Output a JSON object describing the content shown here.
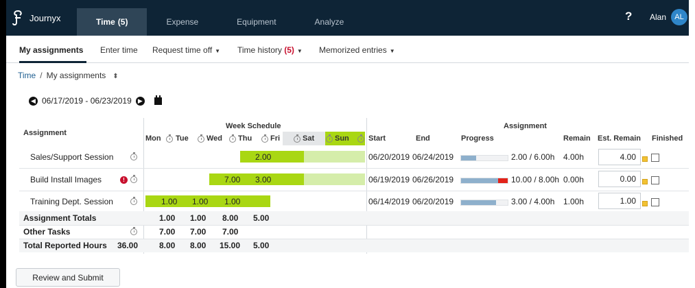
{
  "app": {
    "name": "Journyx"
  },
  "topnav": {
    "tabs": [
      {
        "label": "Time",
        "count": "(5)"
      },
      {
        "label": "Expense"
      },
      {
        "label": "Equipment"
      },
      {
        "label": "Analyze"
      }
    ],
    "help": "?",
    "user": "Alan",
    "avatar_initials": "AL"
  },
  "subnav": {
    "items": [
      {
        "label": "My assignments"
      },
      {
        "label": "Enter time"
      },
      {
        "label": "Request time off"
      },
      {
        "label": "Time history",
        "count": "(5)"
      },
      {
        "label": "Memorized entries"
      }
    ]
  },
  "breadcrumb": {
    "root": "Time",
    "separator": "/",
    "current": "My assignments"
  },
  "date_range": "06/17/2019 - 06/23/2019",
  "table": {
    "header": {
      "assignment": "Assignment",
      "week_schedule": "Week Schedule",
      "assignment_group": "Assignment",
      "days": [
        "Mon",
        "Tue",
        "Wed",
        "Thu",
        "Fri",
        "Sat",
        "Sun"
      ],
      "start": "Start",
      "end": "End",
      "progress": "Progress",
      "remain": "Remain",
      "est_remain": "Est. Remain",
      "finished": "Finished"
    },
    "rows": [
      {
        "name": "Sales/Support Session",
        "values": [
          "2.00"
        ],
        "start": "06/20/2019",
        "end": "06/24/2019",
        "progress_text": "2.00 / 6.00h",
        "progress": 0.33,
        "remain": "4.00h",
        "est_remain": "4.00"
      },
      {
        "name": "Build Install Images",
        "values": [
          "7.00",
          "3.00"
        ],
        "start": "06/19/2019",
        "end": "06/26/2019",
        "progress_text": "10.00 / 8.00h",
        "progress": 1.25,
        "remain": "0.00h",
        "est_remain": "0.00"
      },
      {
        "name": "Training Dept. Session",
        "values": [
          "1.00",
          "1.00",
          "1.00"
        ],
        "start": "06/14/2019",
        "end": "06/20/2019",
        "progress_text": "3.00 / 4.00h",
        "progress": 0.75,
        "remain": "1.00h",
        "est_remain": "1.00"
      }
    ],
    "totals": [
      {
        "label": "Assignment Totals",
        "total": "",
        "values": [
          "1.00",
          "1.00",
          "8.00",
          "5.00"
        ]
      },
      {
        "label": "Other Tasks",
        "total": "",
        "values": [
          "7.00",
          "7.00",
          "7.00"
        ]
      },
      {
        "label": "Total Reported Hours",
        "total": "36.00",
        "values": [
          "8.00",
          "8.00",
          "15.00",
          "5.00"
        ]
      }
    ]
  },
  "submit_label": "Review and Submit",
  "colors": {
    "nav": "#0e2436",
    "bar": "#a9d713",
    "bar_light": "#d5edaa",
    "progress": "#8eb0cc",
    "over": "#e2231a"
  }
}
